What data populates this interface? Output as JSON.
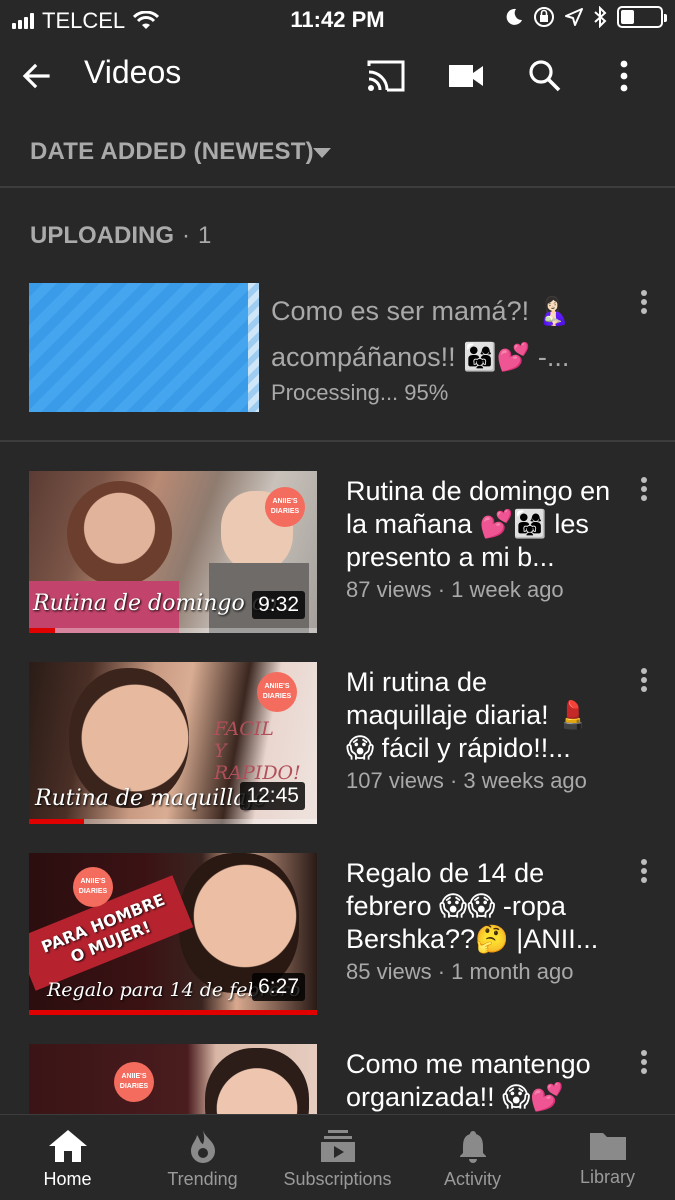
{
  "status_bar": {
    "carrier": "TELCEL",
    "time": "11:42 PM",
    "battery_level": 0.35,
    "icons": [
      "signal-icon",
      "wifi-icon",
      "moon-icon",
      "orientation-lock-icon",
      "location-icon",
      "bluetooth-icon",
      "battery-icon"
    ]
  },
  "header": {
    "title": "Videos",
    "icons": [
      "back-arrow-icon",
      "cast-icon",
      "camera-icon",
      "search-icon",
      "more-vertical-icon"
    ]
  },
  "sort": {
    "label": "DATE ADDED (NEWEST)"
  },
  "uploading": {
    "label": "UPLOADING",
    "separator": "·",
    "count": "1",
    "item": {
      "title": "Como es ser mamá?! 🤱🏻 acompáñanos!! 👨‍👩‍👧💕 -...",
      "status": "Processing... 95%",
      "progress": 0.95
    }
  },
  "videos": [
    {
      "title": "Rutina de domingo en la mañana 💕👨‍👩‍👧 les presento a mi b...",
      "meta": "87 views · 1 week ago",
      "duration": "9:32",
      "watched": 0.09,
      "thumb_text": "Rutina de domingo co...",
      "thumb_badge": "ANIIE'S DIARIES"
    },
    {
      "title": "Mi rutina de maquillaje diaria! 💄 😱 fácil y rápido!!...",
      "meta": "107 views · 3 weeks ago",
      "duration": "12:45",
      "watched": 0.19,
      "thumb_text": "Rutina de maquillaje",
      "thumb_badge": "ANIIE'S DIARIES",
      "thumb_side": "FACIL Y RAPIDO!"
    },
    {
      "title": "Regalo de 14 de febrero 😱😱 -ropa Bershka??🤔 |ANII...",
      "meta": "85 views · 1 month ago",
      "duration": "6:27",
      "watched": 1.0,
      "thumb_text": "Regalo para 14 de febrero",
      "thumb_badge": "ANIIE'S DIARIES",
      "thumb_banner": "PARA HOMBRE O MUJER!"
    },
    {
      "title": "Como me mantengo organizada!! 😱💕",
      "meta": "",
      "duration": "",
      "watched": 0,
      "thumb_text": "",
      "thumb_badge": "ANIIE'S DIARIES"
    }
  ],
  "bottom_nav": [
    {
      "label": "Home",
      "icon": "home-icon",
      "active": true
    },
    {
      "label": "Trending",
      "icon": "flame-icon",
      "active": false
    },
    {
      "label": "Subscriptions",
      "icon": "subscriptions-icon",
      "active": false
    },
    {
      "label": "Activity",
      "icon": "bell-icon",
      "active": false
    },
    {
      "label": "Library",
      "icon": "folder-icon",
      "active": false
    }
  ],
  "colors": {
    "background": "#282828",
    "divider": "#3d3d3d",
    "secondary_text": "#aaaaaa",
    "upload_blue": "#3a9be8",
    "progress_red": "#e10000",
    "badge_coral": "#f36c5d"
  }
}
